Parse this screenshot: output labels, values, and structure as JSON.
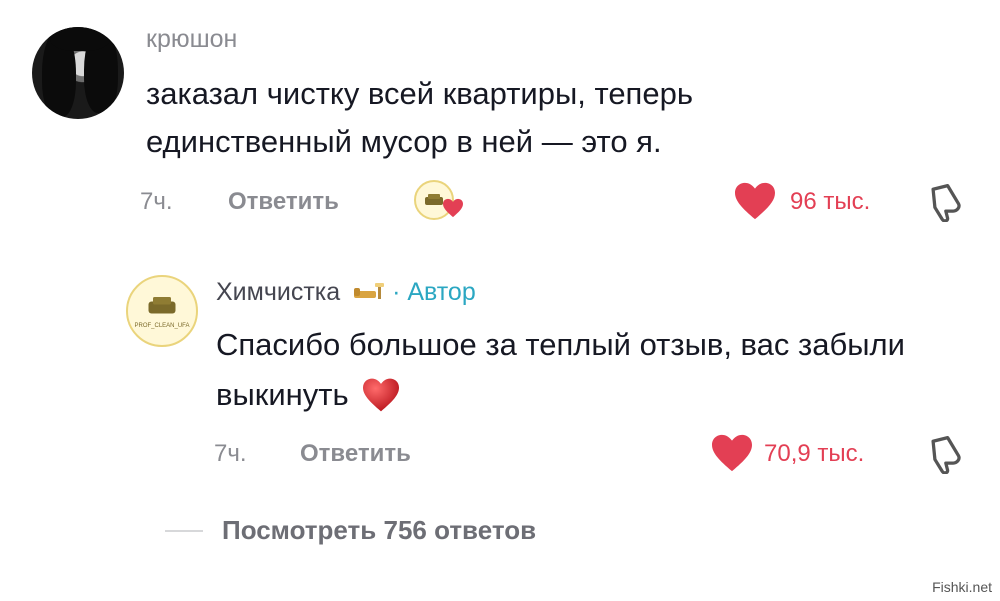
{
  "comment": {
    "username": "крюшон",
    "text": "заказал чистку всей квартиры, теперь единственный мусор в ней — это я.",
    "time": "7ч.",
    "reply_label": "Ответить",
    "likes": "96 тыс.",
    "creator_liked": true
  },
  "reply": {
    "author": "Химчистка",
    "author_badge": "· Автор",
    "text": "Спасибо большое за теплый отзыв, вас забыли выкинуть",
    "time": "7ч.",
    "reply_label": "Ответить",
    "likes": "70,9 тыс."
  },
  "view_replies": "Посмотреть 756 ответов",
  "logo_text": "PROF_CLEAN_UFA",
  "watermark": "Fishki.net",
  "colors": {
    "like": "#e33f54",
    "author_tag": "#2ba7c2",
    "muted": "#8a8b91"
  },
  "icons": [
    "heart-icon",
    "dislike-icon",
    "sofa-emoji-icon",
    "red-heart-emoji-icon"
  ]
}
